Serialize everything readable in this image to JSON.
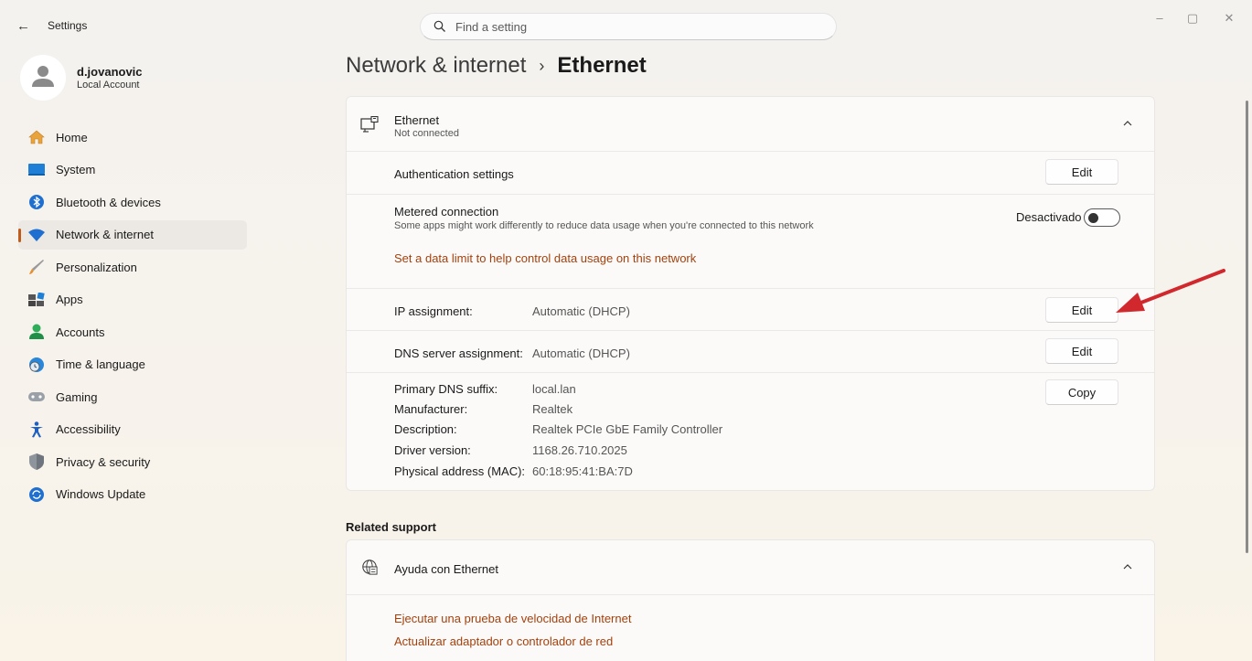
{
  "window": {
    "back_icon": "back-arrow-icon",
    "app_title": "Settings",
    "search_placeholder": "Find a setting",
    "controls": [
      "minimize",
      "restore",
      "close"
    ]
  },
  "profile": {
    "name": "d.jovanovic",
    "account_type": "Local Account"
  },
  "sidebar": {
    "items": [
      {
        "label": "Home",
        "icon": "home-icon",
        "active": false
      },
      {
        "label": "System",
        "icon": "system-icon",
        "active": false
      },
      {
        "label": "Bluetooth & devices",
        "icon": "bluetooth-icon",
        "active": false
      },
      {
        "label": "Network & internet",
        "icon": "wifi-icon",
        "active": true
      },
      {
        "label": "Personalization",
        "icon": "brush-icon",
        "active": false
      },
      {
        "label": "Apps",
        "icon": "apps-icon",
        "active": false
      },
      {
        "label": "Accounts",
        "icon": "accounts-icon",
        "active": false
      },
      {
        "label": "Time & language",
        "icon": "globe-clock-icon",
        "active": false
      },
      {
        "label": "Gaming",
        "icon": "gamepad-icon",
        "active": false
      },
      {
        "label": "Accessibility",
        "icon": "accessibility-icon",
        "active": false
      },
      {
        "label": "Privacy & security",
        "icon": "shield-icon",
        "active": false
      },
      {
        "label": "Windows Update",
        "icon": "update-icon",
        "active": false
      }
    ]
  },
  "breadcrumb": {
    "parent": "Network & internet",
    "separator": "›",
    "current": "Ethernet"
  },
  "ethernet_card": {
    "title": "Ethernet",
    "status": "Not connected",
    "auth_label": "Authentication settings",
    "auth_button": "Edit",
    "metered_label": "Metered connection",
    "metered_desc": "Some apps might work differently to reduce data usage when you're connected to this network",
    "metered_state": "Desactivado",
    "metered_on": false,
    "data_limit_link": "Set a data limit to help control data usage on this network",
    "ip_label": "IP assignment:",
    "ip_value": "Automatic (DHCP)",
    "ip_button": "Edit",
    "dns_label": "DNS server assignment:",
    "dns_value": "Automatic (DHCP)",
    "dns_button": "Edit",
    "details": [
      {
        "label": "Primary DNS suffix:",
        "value": "local.lan"
      },
      {
        "label": "Manufacturer:",
        "value": "Realtek"
      },
      {
        "label": "Description:",
        "value": "Realtek PCIe GbE Family Controller"
      },
      {
        "label": "Driver version:",
        "value": "1168.26.710.2025"
      },
      {
        "label": "Physical address (MAC):",
        "value": "60:18:95:41:BA:7D"
      }
    ],
    "copy_button": "Copy"
  },
  "related_support": {
    "heading": "Related support",
    "card_title": "Ayuda con Ethernet",
    "links": [
      "Ejecutar una prueba de velocidad de Internet",
      "Actualizar adaptador o controlador de red"
    ]
  },
  "colors": {
    "accent": "#c15b1b",
    "link": "#a3410d",
    "annotation_arrow": "#d0282c"
  }
}
